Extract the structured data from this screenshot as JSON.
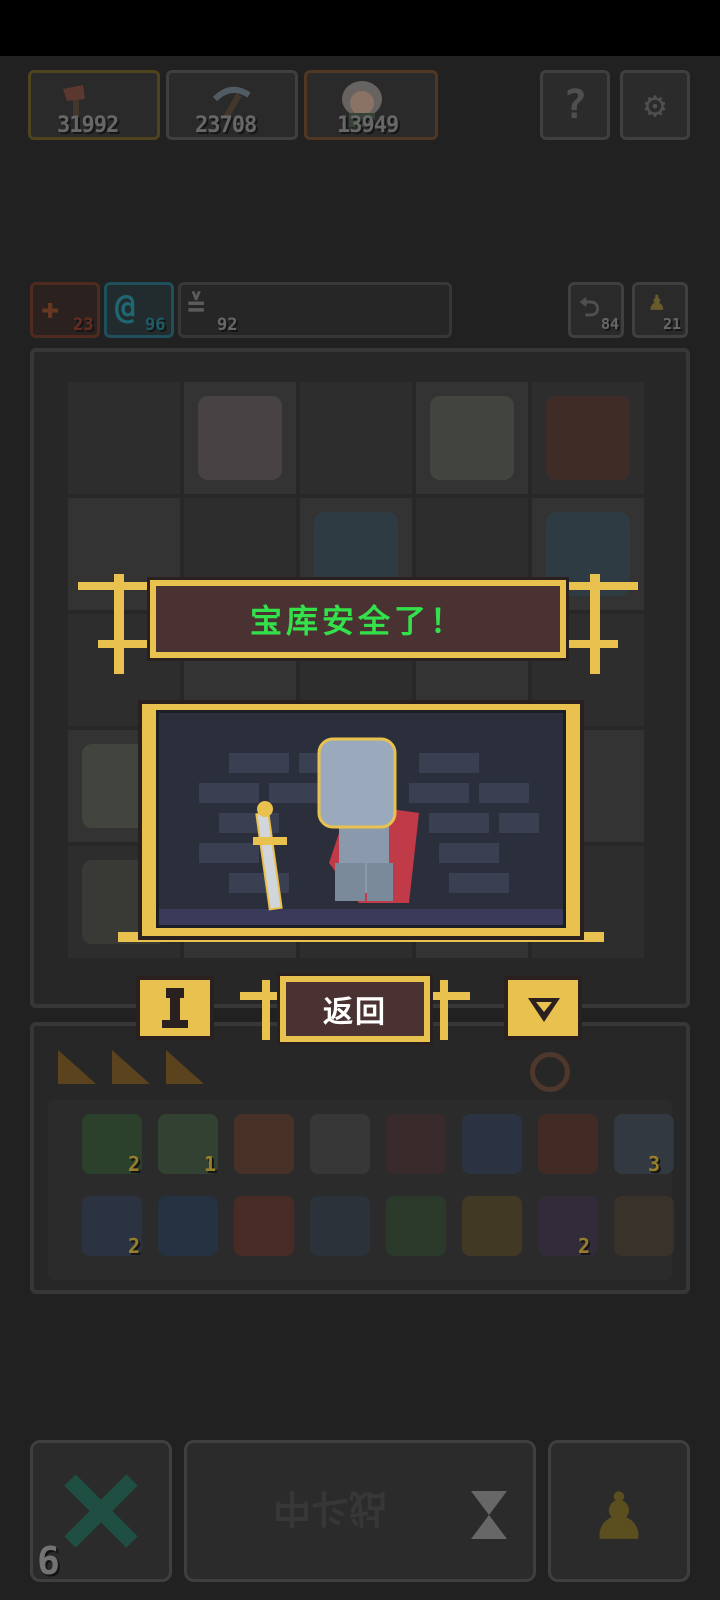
{
  "resources": [
    {
      "icon": "axe-icon",
      "value": "31992"
    },
    {
      "icon": "pickaxe-icon",
      "value": "23708"
    },
    {
      "icon": "hero-portrait-icon",
      "value": "13949"
    }
  ],
  "top_buttons": {
    "help_icon": "question-icon",
    "settings_icon": "gear-icon"
  },
  "status": {
    "attack": "23",
    "magic": "96",
    "speed": "92",
    "turns": "84",
    "keys": "21"
  },
  "overlay": {
    "title": "宝库安全了！",
    "back_label": "返回"
  },
  "inventory_counts": [
    "2",
    "1",
    "3",
    "2",
    "2"
  ],
  "bottom": {
    "battle_label": "战斗中",
    "remaining": "6"
  },
  "colors": {
    "accent_gold": "#e8c14e",
    "title_green": "#33e14a",
    "banner_bg": "#4a3232"
  }
}
